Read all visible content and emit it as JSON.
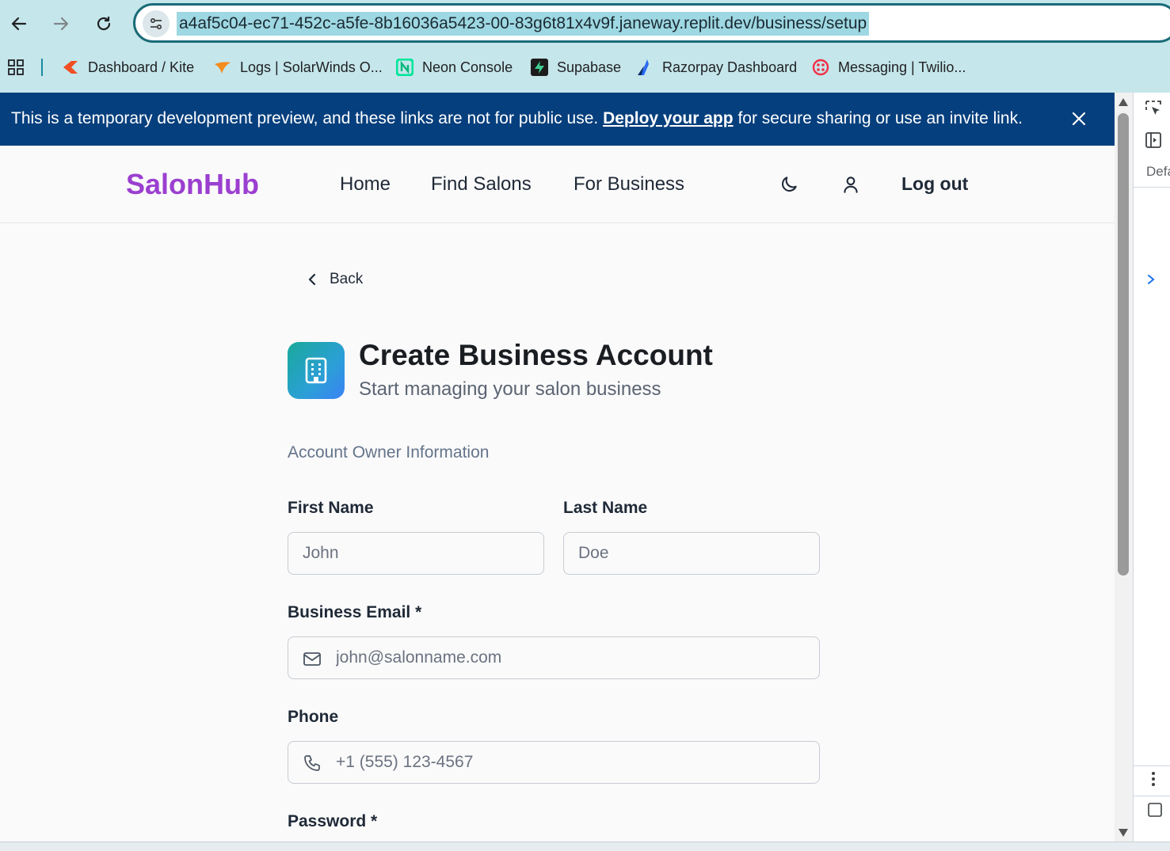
{
  "browser": {
    "url": "a4af5c04-ec71-452c-a5fe-8b16036a5423-00-83g6t81x4v9f.janeway.replit.dev/business/setup",
    "bookmarks": [
      {
        "label": "Dashboard / Kite",
        "icon": "kite-icon",
        "color": "#f04e23"
      },
      {
        "label": "Logs | SolarWinds O...",
        "icon": "solarwinds-icon",
        "color": "#f38b1d"
      },
      {
        "label": "Neon Console",
        "icon": "neon-icon",
        "color": "#00e599"
      },
      {
        "label": "Supabase",
        "icon": "supabase-icon",
        "color": "#3ecf8e"
      },
      {
        "label": "Razorpay Dashboard",
        "icon": "razorpay-icon",
        "color": "#2b6cf6"
      },
      {
        "label": "Messaging | Twilio...",
        "icon": "twilio-icon",
        "color": "#f22f46"
      }
    ]
  },
  "banner": {
    "text_before": "This is a temporary development preview, and these links are not for public use.",
    "link": "Deploy your app",
    "text_after": "for secure sharing or use an invite link."
  },
  "header": {
    "logo": "SalonHub",
    "nav": [
      "Home",
      "Find Salons",
      "For Business"
    ],
    "logout": "Log out"
  },
  "page": {
    "back": "Back",
    "title": "Create Business Account",
    "subtitle": "Start managing your salon business",
    "section": "Account Owner Information",
    "fields": {
      "first_name": {
        "label": "First Name",
        "placeholder": "John"
      },
      "last_name": {
        "label": "Last Name",
        "placeholder": "Doe"
      },
      "email": {
        "label": "Business Email *",
        "placeholder": "john@salonname.com"
      },
      "phone": {
        "label": "Phone",
        "placeholder": "+1 (555) 123-4567"
      },
      "password": {
        "label": "Password *"
      }
    }
  },
  "devtools": {
    "panel_label": "Defa"
  },
  "colors": {
    "brand": "#9b3fd0",
    "banner_bg": "#063f7d",
    "chrome_bg": "#c5e6ea",
    "url_highlight": "#9ed8e2"
  }
}
